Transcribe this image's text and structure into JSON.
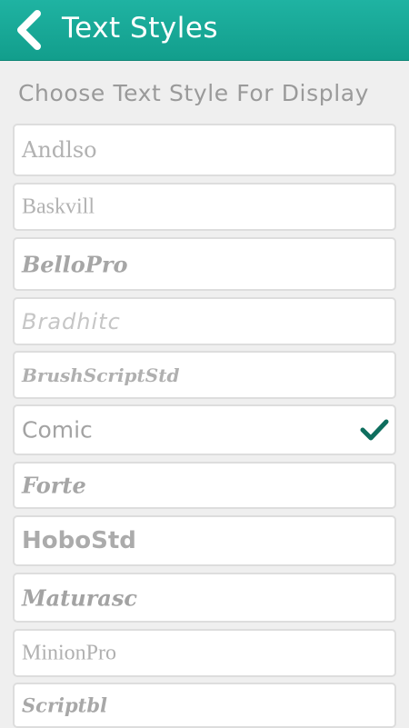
{
  "header": {
    "title": "Text Styles",
    "back_icon": "chevron-left-icon",
    "color": "#16a897"
  },
  "subtitle": "Choose Text Style For Display",
  "styles": [
    {
      "label": "Andlso",
      "selected": false
    },
    {
      "label": "Baskvill",
      "selected": false
    },
    {
      "label": "BelloPro",
      "selected": false
    },
    {
      "label": "Bradhitc",
      "selected": false
    },
    {
      "label": "BrushScriptStd",
      "selected": false
    },
    {
      "label": "Comic",
      "selected": true
    },
    {
      "label": "Forte",
      "selected": false
    },
    {
      "label": "HoboStd",
      "selected": false
    },
    {
      "label": "Maturasc",
      "selected": false
    },
    {
      "label": "MinionPro",
      "selected": false
    },
    {
      "label": "Scriptbl",
      "selected": false
    }
  ],
  "check_icon": "checkmark-icon",
  "check_color": "#0e6e5e"
}
